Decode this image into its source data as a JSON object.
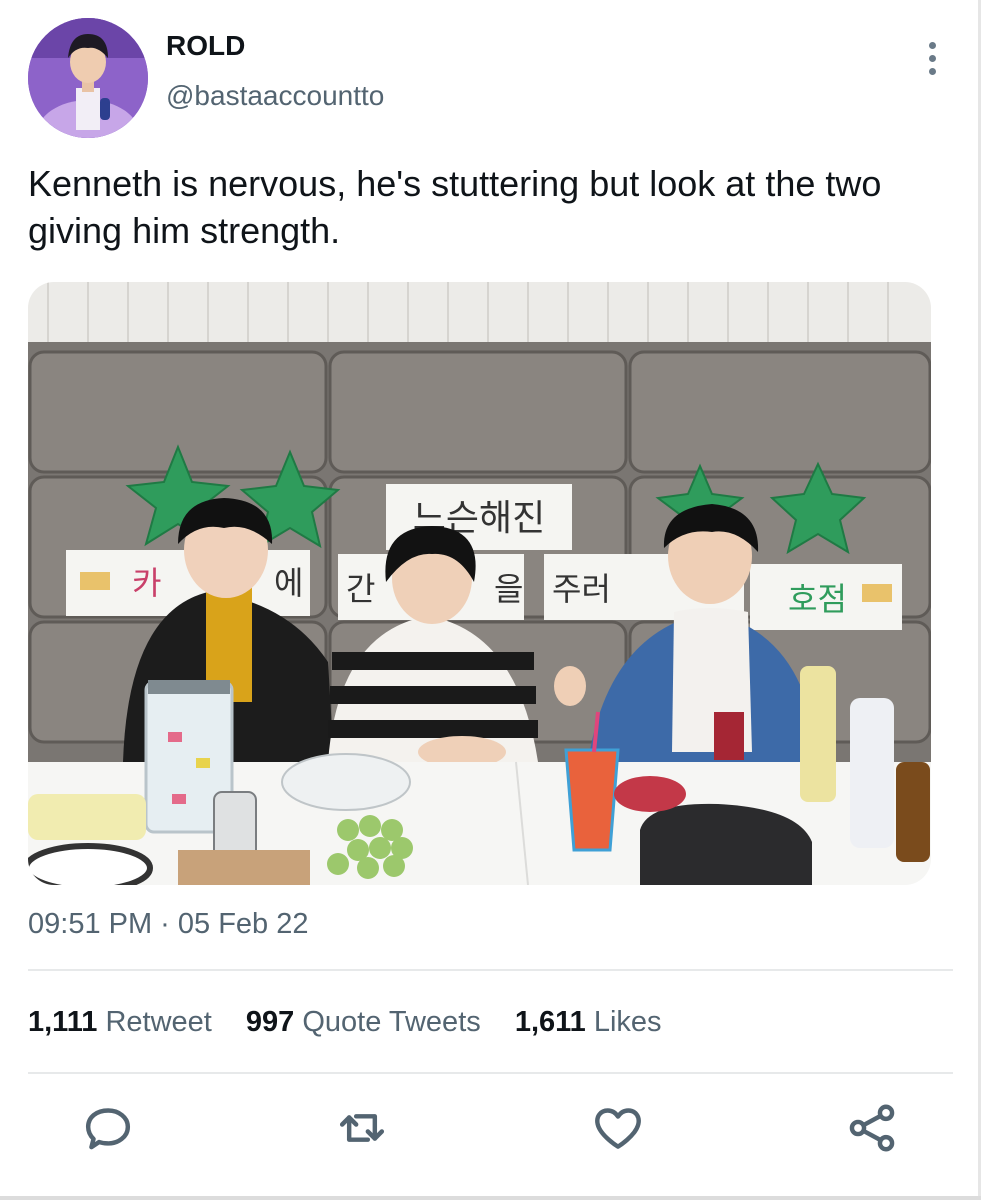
{
  "tweet": {
    "display_name": "ROLD",
    "handle": "@bastaaccountto",
    "text": "Kenneth is nervous, he's stuttering but look at the two giving him strength.",
    "timestamp": "09:51 PM · 05 Feb 22"
  },
  "media": {
    "sign_top": "느슨해진",
    "sign_bottom": [
      "카",
      "에",
      "간",
      "을",
      "주러",
      "호점"
    ]
  },
  "stats": {
    "retweets": {
      "count": "1,111",
      "label": "Retweet"
    },
    "quotes": {
      "count": "997",
      "label": "Quote Tweets"
    },
    "likes": {
      "count": "1,611",
      "label": "Likes"
    }
  },
  "icons": {
    "reply": "reply-icon",
    "retweet": "retweet-icon",
    "like": "heart-icon",
    "share": "share-icon",
    "more": "more-vertical-icon"
  },
  "colors": {
    "text": "#0f1419",
    "secondary": "#536471",
    "icon": "#536471",
    "divider": "#e7e9ea"
  }
}
